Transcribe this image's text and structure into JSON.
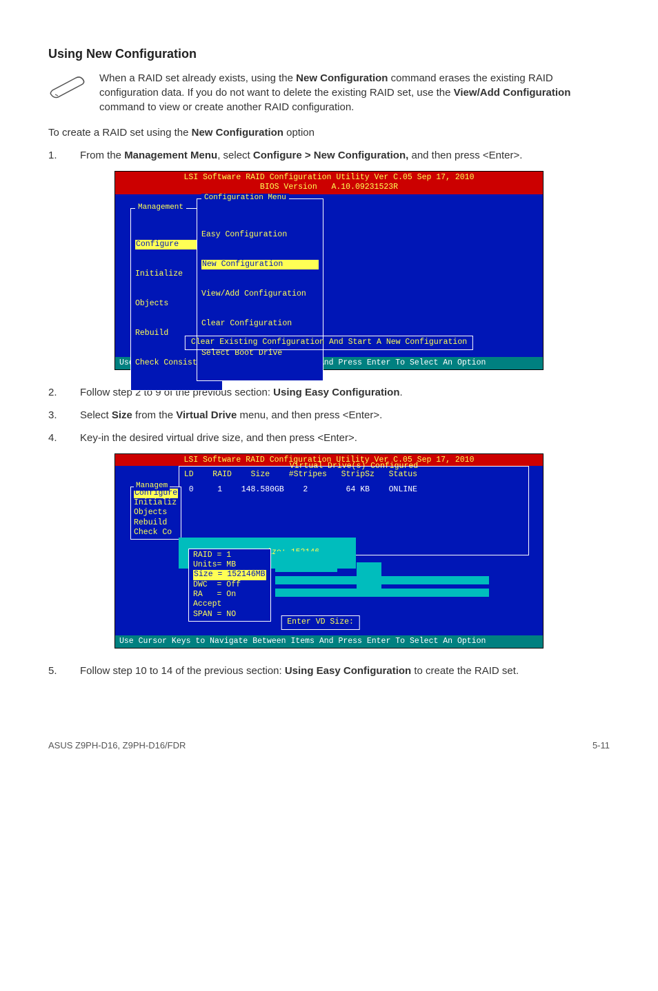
{
  "sectionHeading": "Using New Configuration",
  "note": {
    "prefix": "When a RAID set already exists, using the ",
    "bold1": "New Configuration",
    "mid": " command erases the existing RAID configuration data. If you do not want to delete the existing RAID set, use the ",
    "bold2": "View/Add Configuration",
    "suffix": " command to view or create another RAID configuration."
  },
  "intro": {
    "prefix": "To create a RAID set using the ",
    "bold": "New Configuration",
    "suffix": " option"
  },
  "step1": {
    "num": "1.",
    "a": "From the ",
    "b": "Management Menu",
    "c": ", select ",
    "d": "Configure > New Configuration,",
    "e": " and then press <Enter>."
  },
  "bios1": {
    "headerL1": "LSI Software RAID Configuration Utility Ver C.05 Sep 17, 2010",
    "headerL2": "BIOS Version   A.10.09231523R",
    "mgmtTitle": "Management",
    "mgmtItems": [
      "Configure",
      "Initialize",
      "Objects",
      "Rebuild",
      "Check Consistency"
    ],
    "cfgTitle": "Configuration Menu",
    "cfgItems": [
      "Easy Configuration",
      "New Configuration",
      "View/Add Configuration",
      "Clear Configuration",
      "Select Boot Drive"
    ],
    "msg": "Clear Existing Configuration And Start A New Configuration",
    "footer": "Use Cursor Keys to Navigate Between Items And Press Enter To Select An Option"
  },
  "step2": {
    "num": "2.",
    "a": "Follow step 2 to 9 of the previous section: ",
    "b": "Using Easy Configuration",
    "c": "."
  },
  "step3": {
    "num": "3.",
    "a": "Select ",
    "b": "Size",
    "c": " from the ",
    "d": "Virtual Drive",
    "e": " menu, and then press <Enter>."
  },
  "step4": {
    "num": "4.",
    "t": "Key-in the desired virtual drive size, and then press <Enter>."
  },
  "bios2": {
    "headerL1": "LSI Software RAID Configuration Utility Ver C.05 Sep 17, 2010",
    "subTitle": "Virtual Drive(s) Configured",
    "tableHead": " LD    RAID    Size    #Stripes   StripSz   Status",
    "tableRow": "  0     1    148.580GB    2        64 KB    ONLINE",
    "sideTitle": "Managem",
    "sideItems": [
      "Configure",
      "Initializ",
      "Objects",
      "Rebuild",
      "Check Co"
    ],
    "vdSizeLabel": "Enter VD Size: 152146",
    "props": [
      "RAID = 1",
      "Units= MB",
      "Size = 152146MB",
      "DWC  = Off",
      "RA   = On",
      "Accept",
      "SPAN = NO"
    ],
    "msg": "Enter VD Size:",
    "footer": "Use Cursor Keys to Navigate Between Items And Press Enter To Select An Option"
  },
  "step5": {
    "num": "5.",
    "a": "Follow step 10 to 14 of the previous section: ",
    "b": "Using Easy Configuration",
    "c": " to create the RAID set."
  },
  "footer": {
    "left": "ASUS Z9PH-D16, Z9PH-D16/FDR",
    "right": "5-11"
  }
}
